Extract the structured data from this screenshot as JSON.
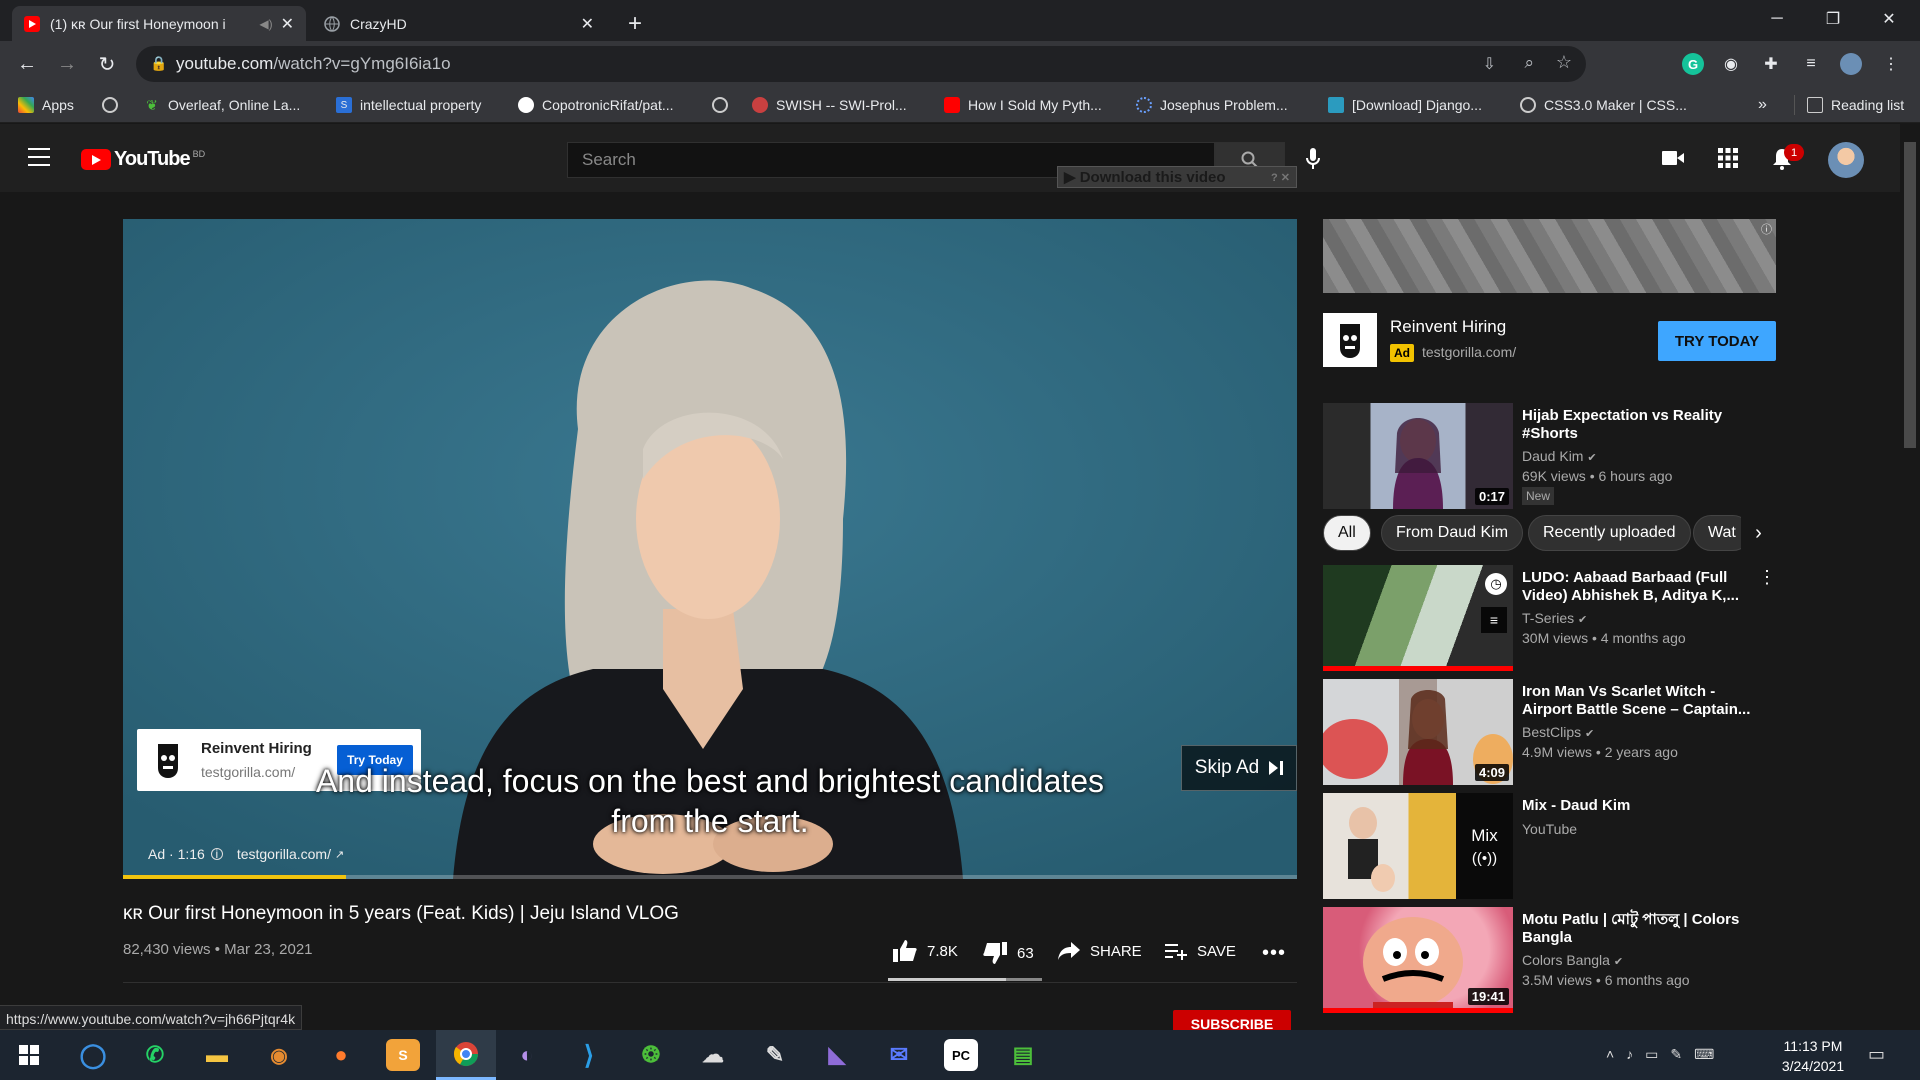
{
  "browser": {
    "tabs": [
      {
        "title": "(1) ᴋʀ Our first Honeymoon i",
        "close": "✕"
      },
      {
        "title": "CrazyHD",
        "close": "✕"
      }
    ],
    "new_tab": "+",
    "window_controls": [
      "─",
      "❐",
      "✕"
    ],
    "url_host": "youtube.com",
    "url_path": "/watch?v=gYmg6I6ia1o",
    "bookmarks": [
      "Apps",
      "Overleaf, Online La...",
      "intellectual property",
      "CopotronicRifat/pat...",
      "SWISH -- SWI-Prol...",
      "How I Sold My Pyth...",
      "Josephus Problem...",
      "[Download] Django...",
      "CSS3.0 Maker | CSS..."
    ],
    "bookmarks_more": "»",
    "reading_list": "Reading list",
    "status_url": "https://www.youtube.com/watch?v=jh66Pjtqr4k"
  },
  "masthead": {
    "logo": "YouTube",
    "logo_region": "BD",
    "search_placeholder": "Search",
    "download_bar": "▶ Download this video",
    "notification_count": "1"
  },
  "player": {
    "ad_title": "Reinvent Hiring",
    "ad_url": "testgorilla.com/",
    "ad_cta": "Try Today",
    "caption_line1": "And instead, focus on the best and brightest candidates",
    "caption_line2": "from the start.",
    "skip_label": "Skip Ad",
    "ad_time": "Ad · 1:16",
    "ad_domain": "testgorilla.com/",
    "progress": 0.19
  },
  "video": {
    "title": "ᴋʀ Our first Honeymoon in 5 years (Feat. Kids) | Jeju Island VLOG",
    "views_date": "82,430 views • Mar 23, 2021",
    "likes": "7.8K",
    "dislikes": "63",
    "share": "SHARE",
    "save": "SAVE",
    "subscribe": "SUBSCRIBE"
  },
  "side_ad": {
    "title": "Reinvent Hiring",
    "badge": "Ad",
    "url": "testgorilla.com/",
    "cta": "TRY TODAY"
  },
  "chips": [
    "All",
    "From Daud Kim",
    "Recently uploaded",
    "Wat"
  ],
  "recs": [
    {
      "title": "Hijab Expectation vs Reality #Shorts",
      "channel": "Daud Kim",
      "meta": "69K views • 6 hours ago",
      "badge": "New",
      "duration": "0:17"
    },
    {
      "title": "LUDO: Aabaad Barbaad (Full Video) Abhishek B, Aditya K,...",
      "channel": "T-Series",
      "meta": "30M views • 4 months ago",
      "duration": ""
    },
    {
      "title": "Iron Man Vs Scarlet Witch - Airport Battle Scene – Captain...",
      "channel": "BestClips",
      "meta": "4.9M views • 2 years ago",
      "duration": "4:09"
    },
    {
      "title": "Mix - Daud Kim",
      "channel": "YouTube",
      "meta": "",
      "duration": "",
      "mix_label": "Mix"
    },
    {
      "title": "Motu Patlu | মোটু পাতলু | Colors Bangla",
      "channel": "Colors Bangla",
      "meta": "3.5M views • 6 months ago",
      "duration": "19:41"
    }
  ],
  "taskbar": {
    "time": "11:13 PM",
    "date": "3/24/2021"
  }
}
